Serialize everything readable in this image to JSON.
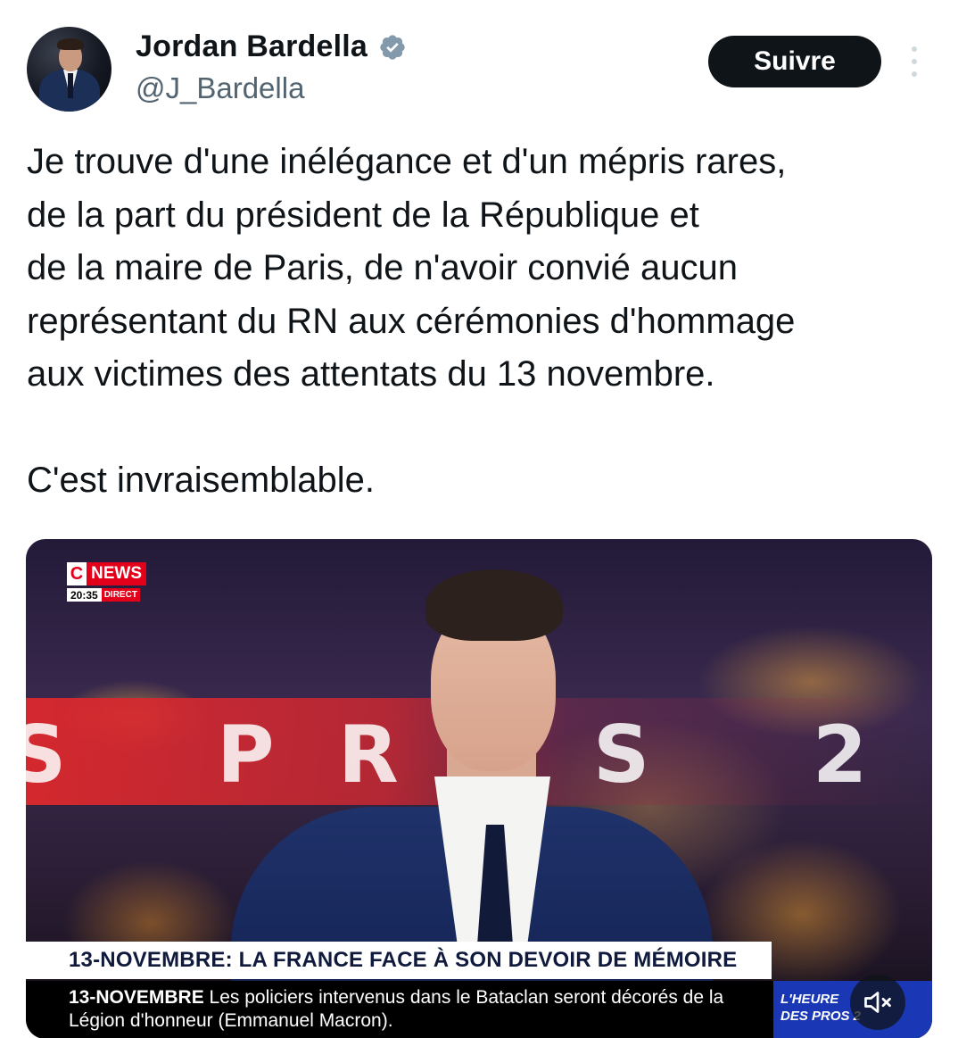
{
  "author": {
    "display_name": "Jordan Bardella",
    "handle": "@J_Bardella",
    "verified": true
  },
  "follow_button": {
    "label": "Suivre"
  },
  "tweet": {
    "lines": [
      "Je trouve d'une inélégance et d'un mépris rares,",
      "de la part du président de la République et",
      "de la maire de Paris, de n'avoir convié aucun",
      "représentant du RN aux cérémonies d'hommage",
      "aux victimes des attentats du 13 novembre."
    ],
    "closing": "C'est invraisemblable."
  },
  "media": {
    "channel_logo": {
      "c": "C",
      "name": "NEWS",
      "time": "20:35",
      "live": "DIRECT"
    },
    "background_letters": [
      "S",
      "P",
      "R",
      "S",
      "2"
    ],
    "headline": "13-NOVEMBRE: LA FRANCE FACE À SON DEVOIR DE MÉMOIRE",
    "ticker": {
      "tag": "13-NOVEMBRE",
      "line1": "Les policiers intervenus dans le Bataclan seront décorés de la",
      "line2": "Légion d'honneur (Emmanuel Macron)."
    },
    "show_name": {
      "line1": "L'HEURE",
      "line2": "DES PROS 2"
    }
  },
  "icons": {
    "verified": "verified-badge-icon",
    "more": "more-vertical-icon",
    "mute": "speaker-muted-icon"
  },
  "colors": {
    "text": "#0f1419",
    "secondary": "#536471",
    "button_bg": "#0f1419",
    "verified": "#829aab",
    "cnews_red": "#e2001a",
    "show_blue": "#1a37b5"
  }
}
